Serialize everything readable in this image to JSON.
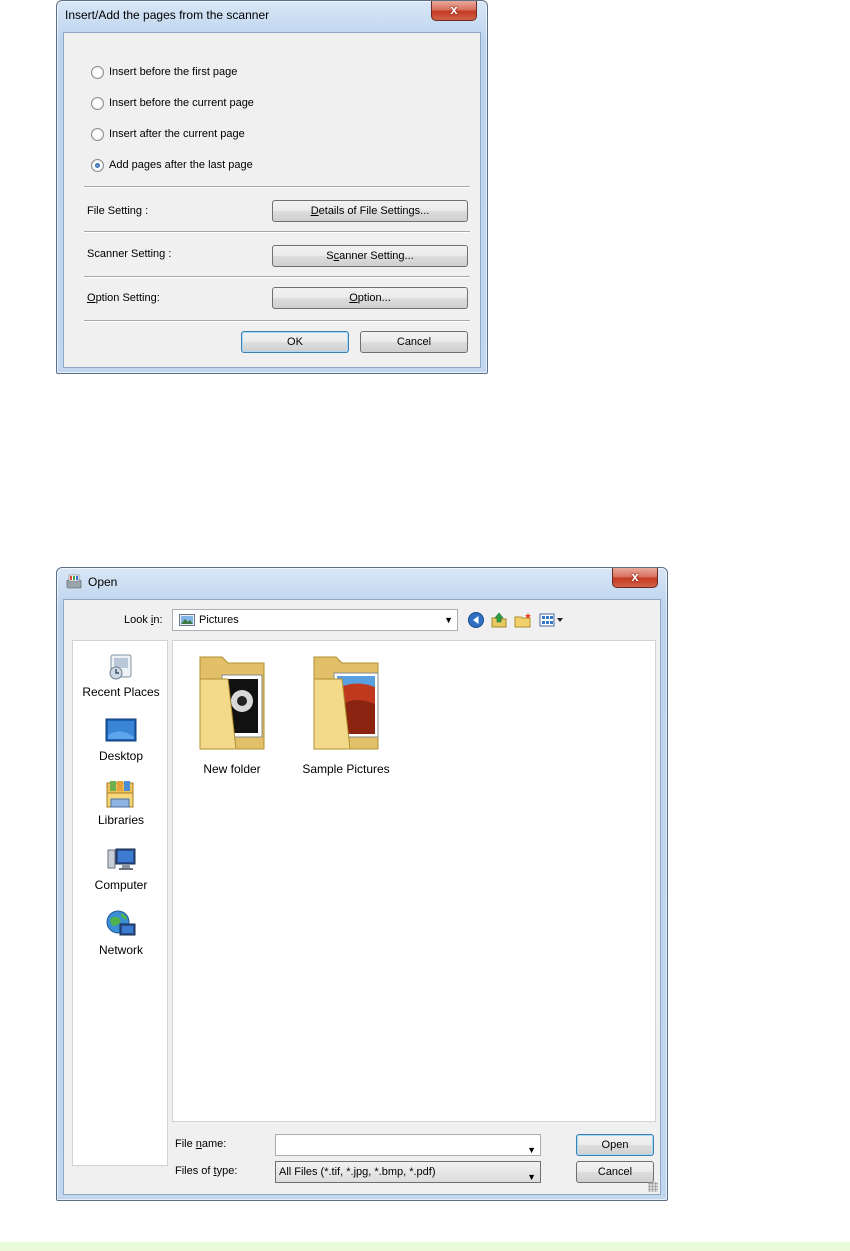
{
  "scan_dialog": {
    "title": "Insert/Add the pages from the scanner",
    "close_glyph": "x",
    "options": [
      {
        "pre": "Insert before the first page",
        "u": "",
        "post": "",
        "checked": false
      },
      {
        "pre": "Insert before the current page",
        "u": "",
        "post": "",
        "checked": false
      },
      {
        "pre": "Insert after the current page",
        "u": "",
        "post": "",
        "checked": false
      },
      {
        "pre": "Add pages after the last pa",
        "u": "g",
        "post": "e",
        "checked": true
      }
    ],
    "file_setting": {
      "label": "File Setting :",
      "button_u": "D",
      "button_rest": "etails of File Settings..."
    },
    "scanner_setting": {
      "label": "Scanner Setting :",
      "button_pre": "S",
      "button_u": "c",
      "button_rest": "anner Setting..."
    },
    "option_setting": {
      "label_u": "O",
      "label_rest": "ption Setting:",
      "button_u": "O",
      "button_rest": "ption..."
    },
    "ok_label": "OK",
    "cancel_label": "Cancel"
  },
  "open_dialog": {
    "title": "Open",
    "close_glyph": "x",
    "look_in": {
      "label_pre": "Look ",
      "label_u": "i",
      "label_post": "n:",
      "value": "Pictures"
    },
    "places": [
      {
        "label": "Recent Places",
        "icon": "recent-places-icon"
      },
      {
        "label": "Desktop",
        "icon": "desktop-icon"
      },
      {
        "label": "Libraries",
        "icon": "libraries-icon"
      },
      {
        "label": "Computer",
        "icon": "computer-icon"
      },
      {
        "label": "Network",
        "icon": "network-icon"
      }
    ],
    "files": [
      {
        "name": "New folder",
        "icon": "folder-icon"
      },
      {
        "name": "Sample Pictures",
        "icon": "folder-icon"
      }
    ],
    "file_name": {
      "label_pre": "File ",
      "label_u": "n",
      "label_post": "ame:",
      "value": ""
    },
    "file_type": {
      "label_pre": "Files of ",
      "label_u": "t",
      "label_post": "ype:",
      "value": "All Files (*.tif, *.jpg, *.bmp, *.pdf)"
    },
    "open_label": "Open",
    "cancel_label": "Cancel"
  }
}
